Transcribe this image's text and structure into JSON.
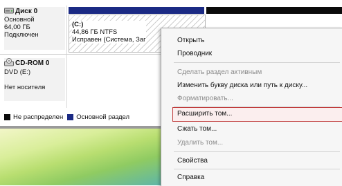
{
  "disks": [
    {
      "icon": "hard-disk-icon",
      "name": "Диск 0",
      "type": "Основной",
      "size": "64,00 ГБ",
      "status": "Подключен"
    },
    {
      "icon": "cdrom-icon",
      "name": "CD-ROM 0",
      "type": "DVD (E:)",
      "status": "Нет носителя"
    }
  ],
  "partition": {
    "letter": "(C:)",
    "size_fs": "44,86 ГБ NTFS",
    "status": "Исправен (Система, Заг"
  },
  "legend": [
    {
      "label": "Не распределен",
      "color": "#0b0b0b"
    },
    {
      "label": "Основной раздел",
      "color": "#1b2a84"
    }
  ],
  "context_menu": {
    "items": [
      {
        "label": "Открыть",
        "enabled": true
      },
      {
        "label": "Проводник",
        "enabled": true
      },
      {
        "label": "Сделать раздел активным",
        "enabled": false
      },
      {
        "label": "Изменить букву диска или путь к диску...",
        "enabled": true
      },
      {
        "label": "Форматировать...",
        "enabled": false
      },
      {
        "label": "Расширить том...",
        "enabled": true,
        "highlighted": true
      },
      {
        "label": "Сжать том...",
        "enabled": true
      },
      {
        "label": "Удалить том...",
        "enabled": false
      },
      {
        "label": "Свойства",
        "enabled": true
      },
      {
        "label": "Справка",
        "enabled": true
      }
    ]
  },
  "colors": {
    "primary_partition": "#1b2a84",
    "unallocated": "#0b0b0b",
    "highlight_border": "#c03a3a"
  }
}
